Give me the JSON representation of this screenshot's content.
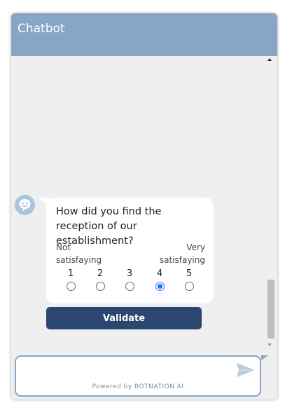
{
  "header": {
    "title": "Chatbot"
  },
  "message": {
    "question": "How did you find the reception of our establishment?",
    "low_label": "Not satisfaying",
    "high_label": "Very satisfaying",
    "ratings": [
      "1",
      "2",
      "3",
      "4",
      "5"
    ],
    "selected_rating": "4",
    "validate_label": "Validate"
  },
  "composer": {
    "placeholder": "",
    "send_icon": "send-icon",
    "powered_prefix": "Powered by",
    "powered_brand": "BOTNATION AI"
  },
  "colors": {
    "header": "#87a6c5",
    "button": "#2b4670",
    "radio_selected": "#1a73e8"
  }
}
